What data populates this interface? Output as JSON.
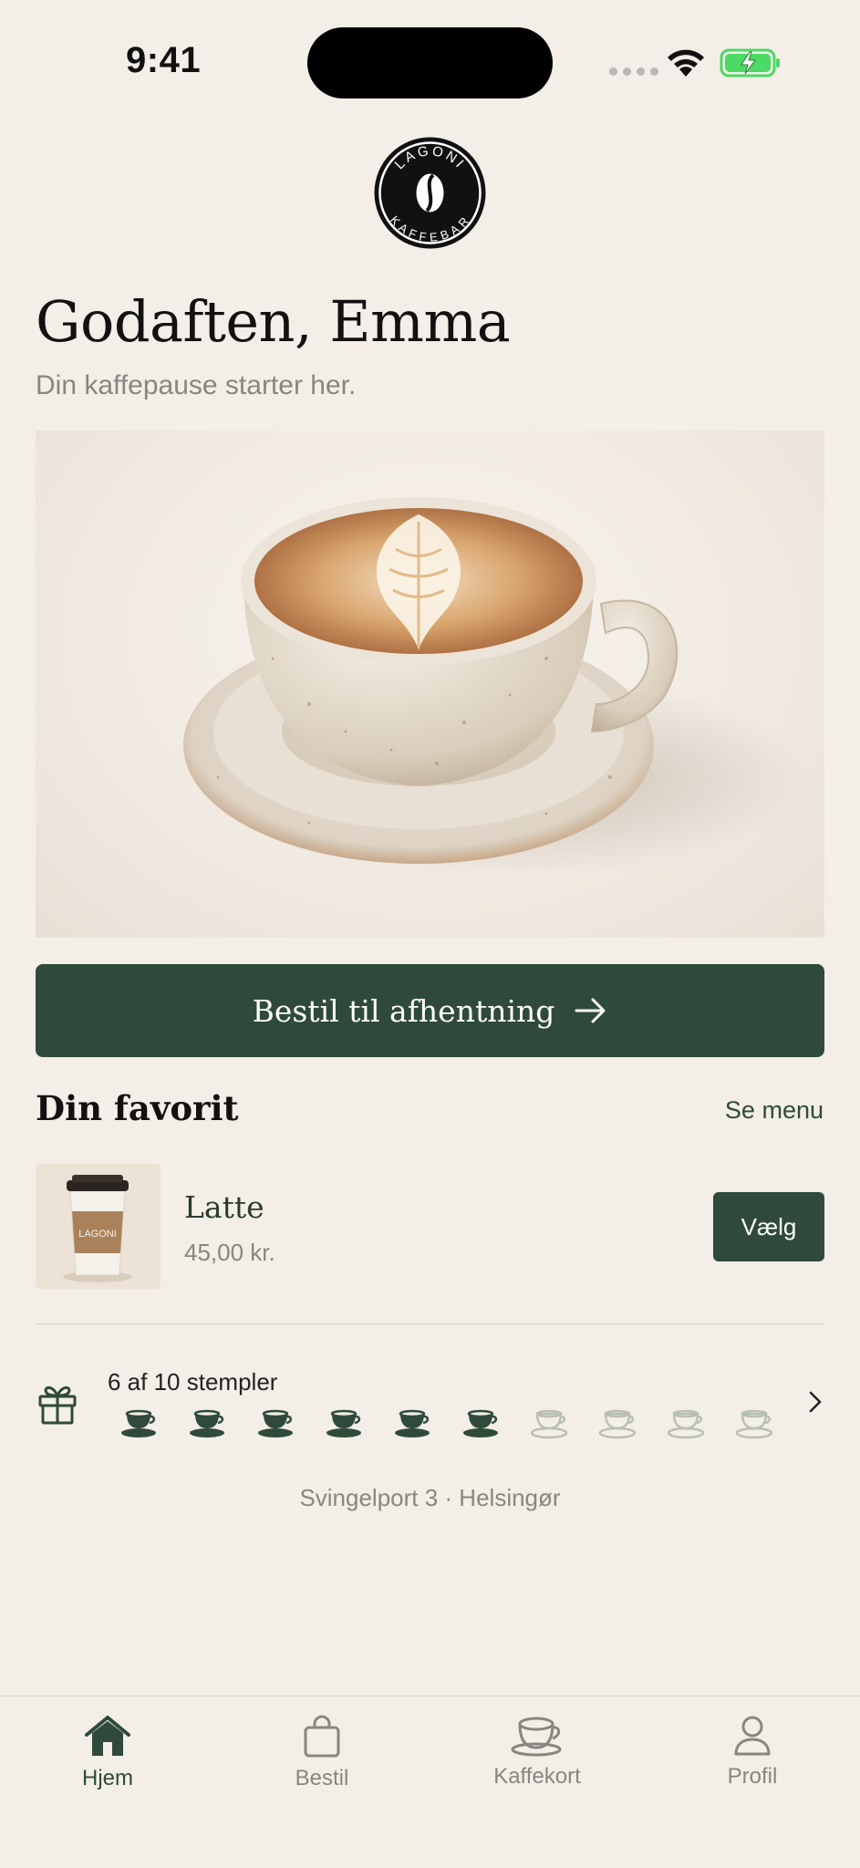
{
  "status_bar": {
    "time": "9:41"
  },
  "logo": {
    "top_text": "LAGONI",
    "bottom_text": "KAFFEBAR"
  },
  "greeting": {
    "title": "Godaften, Emma",
    "subtitle": "Din kaffepause starter her."
  },
  "hero": {
    "image": "latte-art-cup-on-saucer"
  },
  "cta": {
    "label": "Bestil til afhentning",
    "icon": "arrow-right-icon"
  },
  "favorite": {
    "section_title": "Din favorit",
    "see_menu_label": "Se menu",
    "item": {
      "name": "Latte",
      "price": "45,00 kr.",
      "thumb_icon": "takeaway-cup",
      "cup_label": "LAGONI",
      "button_label": "Vælg"
    }
  },
  "stamp_card": {
    "icon": "gift-icon",
    "text": "6 af 10 stempler",
    "collected": 6,
    "total": 10
  },
  "address": "Svingelport 3 · Helsingør",
  "tabs": [
    {
      "label": "Hjem",
      "icon": "home-icon",
      "active": true
    },
    {
      "label": "Bestil",
      "icon": "bag-icon",
      "active": false
    },
    {
      "label": "Kaffekort",
      "icon": "coffee-cup-icon",
      "active": false
    },
    {
      "label": "Profil",
      "icon": "person-icon",
      "active": false
    }
  ],
  "colors": {
    "background": "#f3eee7",
    "accent": "#2f4a3a",
    "muted_text": "#8a8580",
    "stamp_empty": "#b9bfb6",
    "battery_green": "#4cd964"
  }
}
